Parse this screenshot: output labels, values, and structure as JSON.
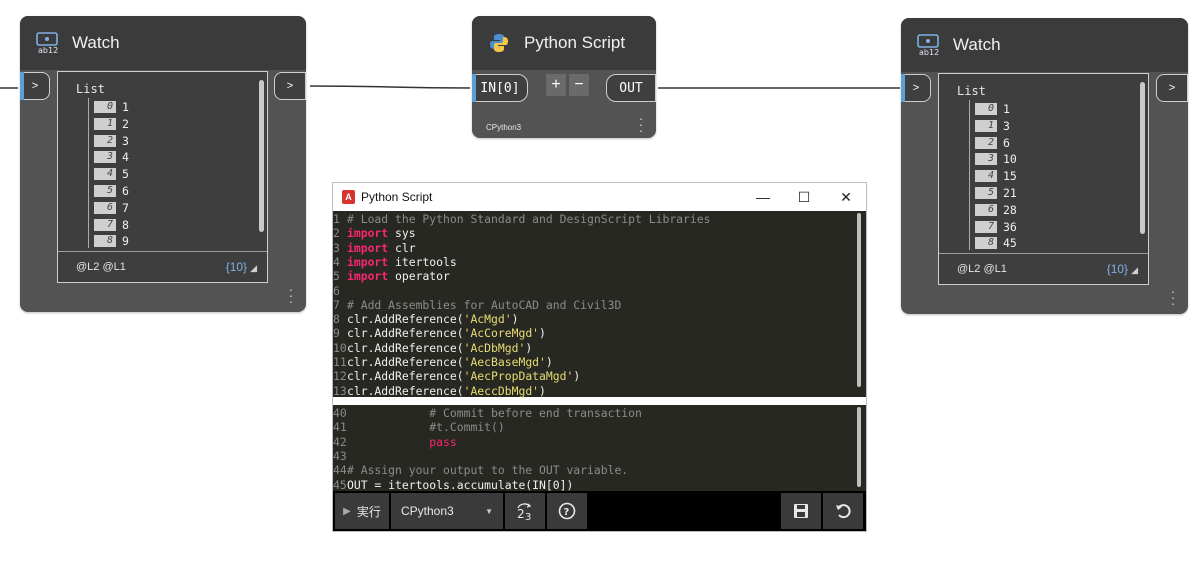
{
  "left_watch": {
    "title": "Watch",
    "icon": "watch-icon",
    "in_port": ">",
    "out_port": ">",
    "list_title": "List",
    "items": [
      {
        "index": "0",
        "value": "1"
      },
      {
        "index": "1",
        "value": "2"
      },
      {
        "index": "2",
        "value": "3"
      },
      {
        "index": "3",
        "value": "4"
      },
      {
        "index": "4",
        "value": "5"
      },
      {
        "index": "5",
        "value": "6"
      },
      {
        "index": "6",
        "value": "7"
      },
      {
        "index": "7",
        "value": "8"
      },
      {
        "index": "8",
        "value": "9"
      }
    ],
    "levels": "@L2 @L1",
    "count": "{10}"
  },
  "python_node": {
    "title": "Python Script",
    "icon": "python-icon",
    "input_port": "IN[0]",
    "add_label": "+",
    "remove_label": "−",
    "output_port": "OUT",
    "engine": "CPython3"
  },
  "right_watch": {
    "title": "Watch",
    "icon": "watch-icon",
    "in_port": ">",
    "out_port": ">",
    "list_title": "List",
    "items": [
      {
        "index": "0",
        "value": "1"
      },
      {
        "index": "1",
        "value": "3"
      },
      {
        "index": "2",
        "value": "6"
      },
      {
        "index": "3",
        "value": "10"
      },
      {
        "index": "4",
        "value": "15"
      },
      {
        "index": "5",
        "value": "21"
      },
      {
        "index": "6",
        "value": "28"
      },
      {
        "index": "7",
        "value": "36"
      },
      {
        "index": "8",
        "value": "45"
      }
    ],
    "levels": "@L2 @L1",
    "count": "{10}"
  },
  "editor": {
    "title": "Python Script",
    "minimize": "—",
    "maximize": "☐",
    "close": "✕",
    "top_lines": [
      {
        "n": "1",
        "t": "# Load the Python Standard and DesignScript Libraries",
        "cls": "cm"
      },
      {
        "n": "2",
        "kw": "import",
        "t": " sys"
      },
      {
        "n": "3",
        "kw": "import",
        "t": " clr"
      },
      {
        "n": "4",
        "kw": "import",
        "t": " itertools"
      },
      {
        "n": "5",
        "kw": "import",
        "t": " operator"
      },
      {
        "n": "6",
        "t": ""
      },
      {
        "n": "7",
        "t": "# Add Assemblies for AutoCAD and Civil3D",
        "cls": "cm"
      },
      {
        "n": "8",
        "t": "clr.AddReference(",
        "s": "'AcMgd'",
        "e": ")"
      },
      {
        "n": "9",
        "t": "clr.AddReference(",
        "s": "'AcCoreMgd'",
        "e": ")"
      },
      {
        "n": "10",
        "t": "clr.AddReference(",
        "s": "'AcDbMgd'",
        "e": ")"
      },
      {
        "n": "11",
        "t": "clr.AddReference(",
        "s": "'AecBaseMgd'",
        "e": ")"
      },
      {
        "n": "12",
        "t": "clr.AddReference(",
        "s": "'AecPropDataMgd'",
        "e": ")"
      },
      {
        "n": "13",
        "t": "clr.AddReference(",
        "s": "'AeccDbMgd'",
        "e": ")"
      }
    ],
    "bottom_lines": [
      {
        "n": "40",
        "t": "            # Commit before end transaction",
        "cls": "cm"
      },
      {
        "n": "41",
        "t": "            #t.Commit()",
        "cls": "cm"
      },
      {
        "n": "42",
        "t": "            ",
        "kw2": "pass"
      },
      {
        "n": "43",
        "t": ""
      },
      {
        "n": "44",
        "t": "# Assign your output to the OUT variable.",
        "cls": "cm"
      },
      {
        "n": "45",
        "t": "OUT = itertools.accumulate(IN[0])"
      }
    ],
    "run_label": "実行",
    "engine_select": "CPython3",
    "toolbar_icons": [
      "run-icon",
      "dropdown-arrow-icon",
      "convert-icon",
      "help-icon",
      "save-icon",
      "revert-icon"
    ]
  }
}
